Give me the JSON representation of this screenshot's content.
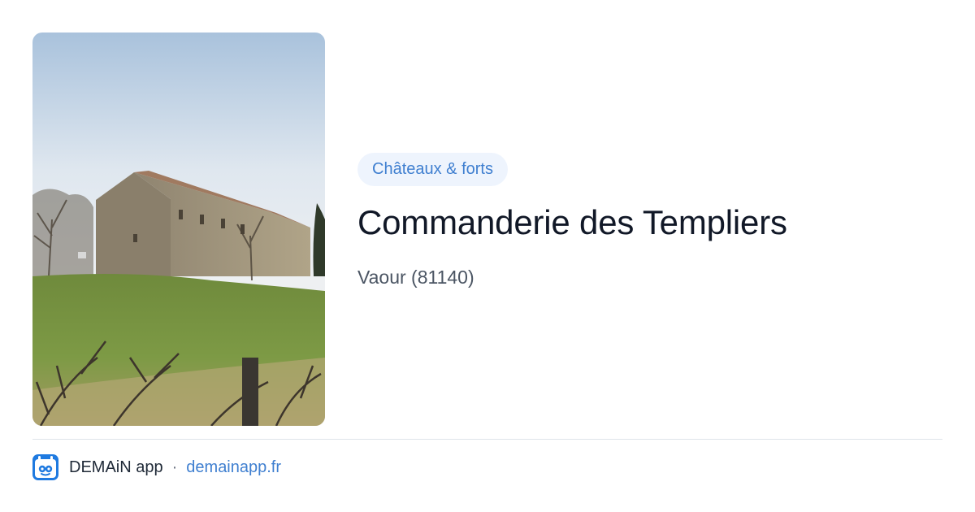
{
  "card": {
    "image": {
      "icon": "photo-commanderie",
      "alt": "Commanderie des Templiers"
    },
    "category": "Châteaux & forts",
    "title": "Commanderie des Templiers",
    "location": "Vaour (81140)"
  },
  "footer": {
    "logo_icon": "demain-app-logo-icon",
    "app_name": "DEMAiN app",
    "separator": "·",
    "url": "demainapp.fr"
  },
  "colors": {
    "accent": "#3f7fd0",
    "tag_background": "#eef4fd",
    "title": "#111827",
    "secondary_text": "#4b5563",
    "divider": "#dfe4ea"
  }
}
